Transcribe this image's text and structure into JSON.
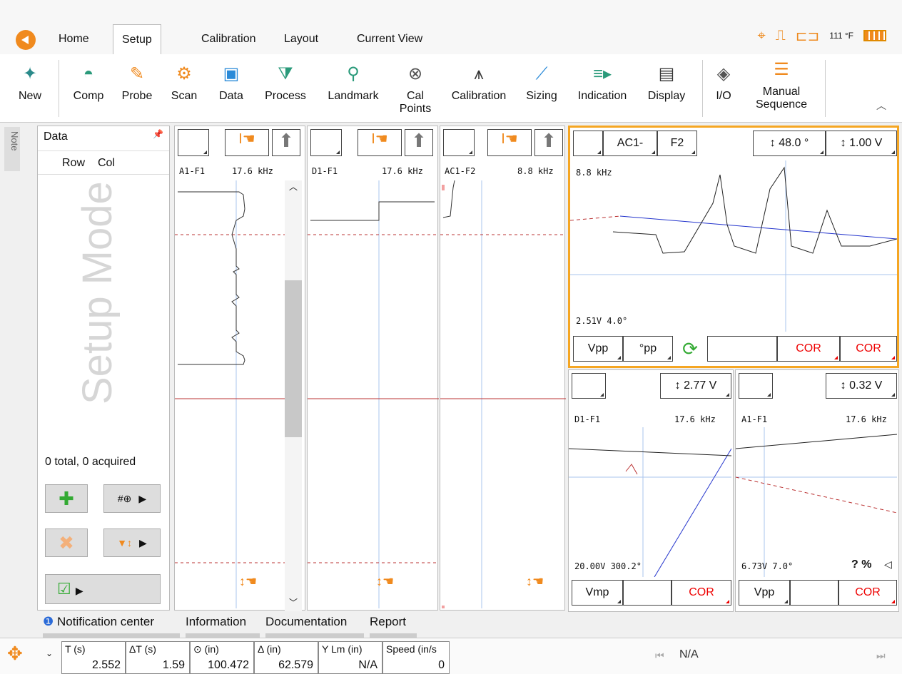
{
  "tabs": [
    "Home",
    "Setup",
    "Calibration",
    "Layout",
    "Current View"
  ],
  "status": {
    "temp": "111 °F"
  },
  "ribbon": {
    "new": "New",
    "comp": "Comp",
    "probe": "Probe",
    "scan": "Scan",
    "data": "Data",
    "process": "Process",
    "landmark": "Landmark",
    "cal_points_1": "Cal",
    "cal_points_2": "Points",
    "calibration": "Calibration",
    "sizing": "Sizing",
    "indication": "Indication",
    "display": "Display",
    "io": "I/O",
    "manual_1": "Manual",
    "manual_2": "Sequence"
  },
  "note_label": "Note",
  "data_panel": {
    "title": "Data",
    "row": "Row",
    "col": "Col",
    "mode": "Setup Mode",
    "total": "0 total, 0 acquired"
  },
  "strips": [
    {
      "name": "A1-F1",
      "freq": "17.6 kHz"
    },
    {
      "name": "D1-F1",
      "freq": "17.6 kHz"
    },
    {
      "name": "AC1-F2",
      "freq": "8.8 kHz"
    }
  ],
  "lissajous_main": {
    "ch": "AC1-",
    "freq_sel": "F2",
    "angle": "48.0 °",
    "volts": "1.00 V",
    "freq": "8.8 kHz",
    "reading": "2.51V 4.0°",
    "vpp": "Vpp",
    "deg": "°pp",
    "cor1": "COR",
    "cor2": "COR"
  },
  "lissajous_d1": {
    "volts": "2.77 V",
    "name": "D1-F1",
    "freq": "17.6 kHz",
    "reading": "20.00V 300.2°",
    "mode": "Vmp",
    "cor": "COR"
  },
  "lissajous_a1": {
    "volts": "0.32 V",
    "name": "A1-F1",
    "freq": "17.6 kHz",
    "reading": "6.73V 7.0°",
    "extra": "? %",
    "mode": "Vpp",
    "cor": "COR"
  },
  "bottom_tabs": [
    "Notification center",
    "Information",
    "Documentation",
    "Report"
  ],
  "measures": [
    {
      "label": "T (s)",
      "value": "2.552"
    },
    {
      "label": "ΔT (s)",
      "value": "1.59"
    },
    {
      "label": "⊙ (in)",
      "value": "100.472"
    },
    {
      "label": "Δ (in)",
      "value": "62.579"
    },
    {
      "label": "Y Lm (in)",
      "value": "N/A"
    },
    {
      "label": "Speed (in/s",
      "value": "0"
    }
  ],
  "nav_value": "N/A"
}
